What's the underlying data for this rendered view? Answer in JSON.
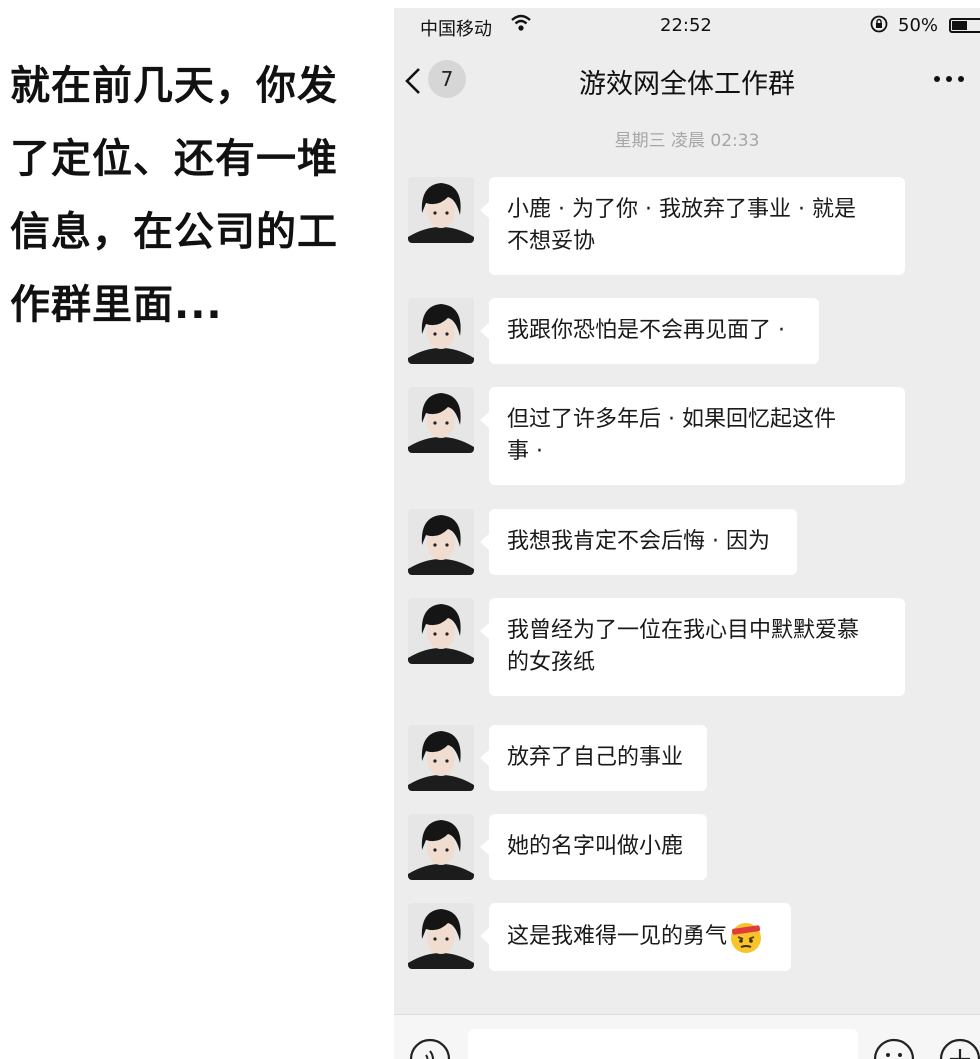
{
  "caption": {
    "lines": [
      "就在前几天，你发",
      "了定位、还有一堆",
      "信息，在公司的工",
      "作群里面..."
    ]
  },
  "statusbar": {
    "carrier": "中国移动",
    "time": "22:52",
    "battery": "50%",
    "battery_level": 0.5
  },
  "navbar": {
    "unread_count": "7",
    "title": "游效网全体工作群"
  },
  "timestamp": "星期三 凌晨 02:33",
  "messages": [
    {
      "text_lines": [
        "小鹿 · 为了你 · 我放弃了事业 · 就是",
        "不想妥协"
      ]
    },
    {
      "text_lines": [
        "我跟你恐怕是不会再见面了 ·"
      ]
    },
    {
      "text_lines": [
        "但过了许多年后 · 如果回忆起这件",
        "事 ·"
      ]
    },
    {
      "text_lines": [
        "我想我肯定不会后悔 · 因为"
      ]
    },
    {
      "text_lines": [
        "我曾经为了一位在我心目中默默爱慕",
        "的女孩纸"
      ]
    },
    {
      "text_lines": [
        "放弃了自己的事业"
      ]
    },
    {
      "text_lines": [
        "她的名字叫做小鹿"
      ]
    },
    {
      "text_lines": [
        "这是我难得一见的勇气"
      ],
      "emoji": "determined-face-emoji"
    }
  ],
  "colors": {
    "chat_background": "#ededed",
    "bubble": "#ffffff",
    "timestamp": "#a6a6a6"
  }
}
